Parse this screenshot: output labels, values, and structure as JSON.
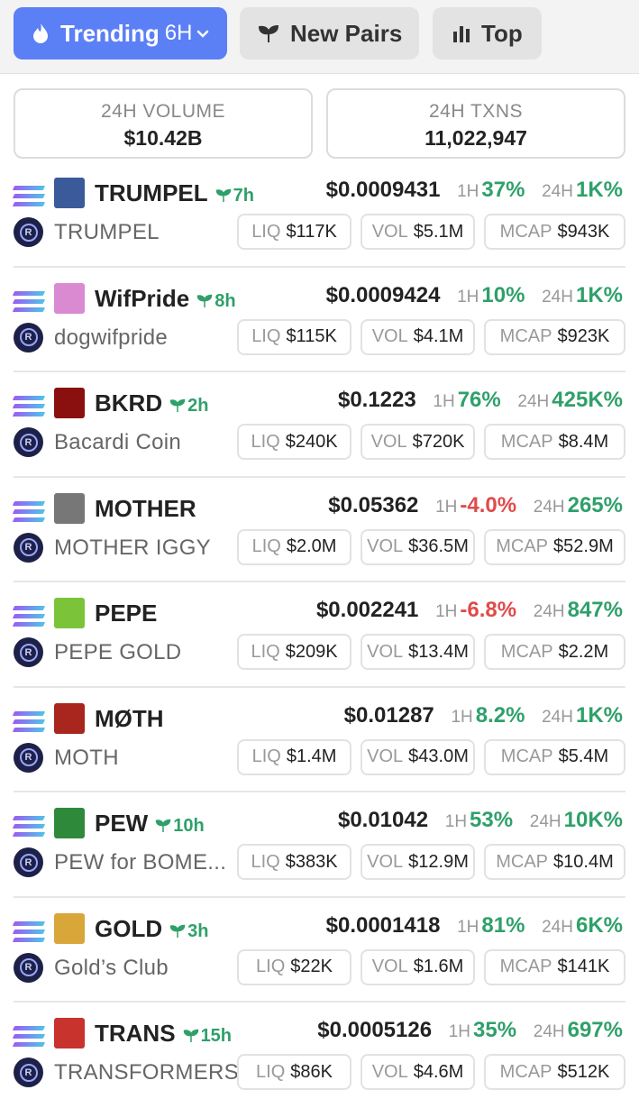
{
  "tabs": {
    "trending_label": "Trending",
    "trending_period": "6H",
    "new_pairs_label": "New Pairs",
    "top_label": "Top"
  },
  "stats": {
    "volume_label": "24H VOLUME",
    "volume_value": "$10.42B",
    "txns_label": "24H TXNS",
    "txns_value": "11,022,947"
  },
  "labels": {
    "h1": "1H",
    "h24": "24H",
    "liq": "LIQ",
    "vol": "VOL",
    "mcap": "MCAP"
  },
  "pairs": [
    {
      "ticker": "TRUMPEL",
      "age": "7h",
      "name": "TRUMPEL",
      "price": "$0.0009431",
      "change_1h": "37%",
      "change_1h_dir": "up",
      "change_24h": "1K%",
      "change_24h_dir": "up",
      "liq": "$117K",
      "vol": "$5.1M",
      "mcap": "$943K",
      "thumb_color": "#3b5a9a"
    },
    {
      "ticker": "WifPride",
      "age": "8h",
      "name": "dogwifpride",
      "price": "$0.0009424",
      "change_1h": "10%",
      "change_1h_dir": "up",
      "change_24h": "1K%",
      "change_24h_dir": "up",
      "liq": "$115K",
      "vol": "$4.1M",
      "mcap": "$923K",
      "thumb_color": "#d98ad1"
    },
    {
      "ticker": "BKRD",
      "age": "2h",
      "name": "Bacardi Coin",
      "price": "$0.1223",
      "change_1h": "76%",
      "change_1h_dir": "up",
      "change_24h": "425K%",
      "change_24h_dir": "up",
      "liq": "$240K",
      "vol": "$720K",
      "mcap": "$8.4M",
      "thumb_color": "#8a1010"
    },
    {
      "ticker": "MOTHER",
      "age": "",
      "name": "MOTHER IGGY",
      "price": "$0.05362",
      "change_1h": "-4.0%",
      "change_1h_dir": "down",
      "change_24h": "265%",
      "change_24h_dir": "up",
      "liq": "$2.0M",
      "vol": "$36.5M",
      "mcap": "$52.9M",
      "thumb_color": "#777777"
    },
    {
      "ticker": "PEPE",
      "age": "",
      "name": "PEPE GOLD",
      "price": "$0.002241",
      "change_1h": "-6.8%",
      "change_1h_dir": "down",
      "change_24h": "847%",
      "change_24h_dir": "up",
      "liq": "$209K",
      "vol": "$13.4M",
      "mcap": "$2.2M",
      "thumb_color": "#7bc43a"
    },
    {
      "ticker": "MØTH",
      "age": "",
      "name": "MOTH",
      "price": "$0.01287",
      "change_1h": "8.2%",
      "change_1h_dir": "up",
      "change_24h": "1K%",
      "change_24h_dir": "up",
      "liq": "$1.4M",
      "vol": "$43.0M",
      "mcap": "$5.4M",
      "thumb_color": "#a8261e"
    },
    {
      "ticker": "PEW",
      "age": "10h",
      "name": "PEW for BOME...",
      "price": "$0.01042",
      "change_1h": "53%",
      "change_1h_dir": "up",
      "change_24h": "10K%",
      "change_24h_dir": "up",
      "liq": "$383K",
      "vol": "$12.9M",
      "mcap": "$10.4M",
      "thumb_color": "#2e8a3a"
    },
    {
      "ticker": "GOLD",
      "age": "3h",
      "name": "Gold’s Club",
      "price": "$0.0001418",
      "change_1h": "81%",
      "change_1h_dir": "up",
      "change_24h": "6K%",
      "change_24h_dir": "up",
      "liq": "$22K",
      "vol": "$1.6M",
      "mcap": "$141K",
      "thumb_color": "#d9a63a"
    },
    {
      "ticker": "TRANS",
      "age": "15h",
      "name": "TRANSFORMERS",
      "price": "$0.0005126",
      "change_1h": "35%",
      "change_1h_dir": "up",
      "change_24h": "697%",
      "change_24h_dir": "up",
      "liq": "$86K",
      "vol": "$4.6M",
      "mcap": "$512K",
      "thumb_color": "#c8332d"
    }
  ]
}
